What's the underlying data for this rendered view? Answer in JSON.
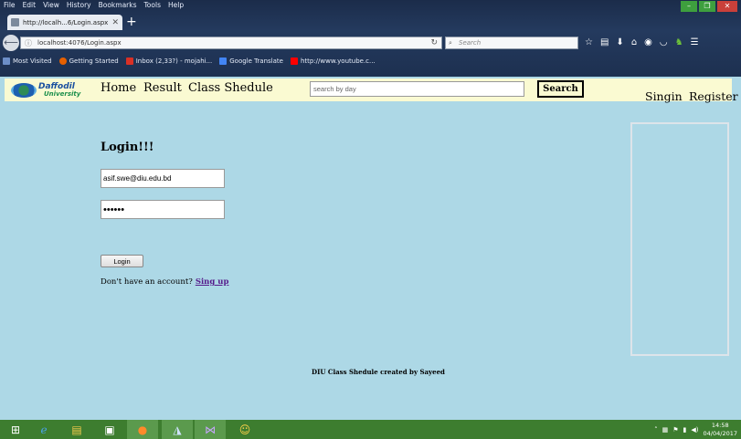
{
  "browser": {
    "menu": [
      "File",
      "Edit",
      "View",
      "History",
      "Bookmarks",
      "Tools",
      "Help"
    ],
    "window_controls": {
      "minimize": "–",
      "maximize": "❐",
      "close": "✕"
    },
    "tab_title": "http://localh...6/Login.aspx",
    "url": "localhost:4076/Login.aspx",
    "search_placeholder": "Search",
    "bookmarks": [
      {
        "label": "Most Visited",
        "icon": "bookmark-icon",
        "color": "#6c8ec7"
      },
      {
        "label": "Getting Started",
        "icon": "firefox-icon",
        "color": "#e66000"
      },
      {
        "label": "Inbox (2,33?) - mojahi...",
        "icon": "gmail-icon",
        "color": "#d93025"
      },
      {
        "label": "Google Translate",
        "icon": "translate-icon",
        "color": "#4285f4"
      },
      {
        "label": "http://www.youtube.c...",
        "icon": "youtube-icon",
        "color": "#ff0000"
      }
    ]
  },
  "site": {
    "logo": {
      "line1": "Daffodil",
      "line2": "University"
    },
    "nav": {
      "home": "Home",
      "result": "Result",
      "schedule": "Class Shedule"
    },
    "search": {
      "placeholder": "search by day",
      "button": "Search"
    },
    "auth": {
      "signin": "Singin",
      "register": "Register"
    }
  },
  "login": {
    "title": "Login!!!",
    "email": "asif.swe@diu.edu.bd",
    "password": "••••••",
    "button": "Login",
    "prompt": "Don't have an account?",
    "signup": "Sing up"
  },
  "footer": {
    "text": "DIU Class Shedule created by Sayeed"
  },
  "taskbar": {
    "time": "14:58",
    "date": "04/04/2017"
  }
}
